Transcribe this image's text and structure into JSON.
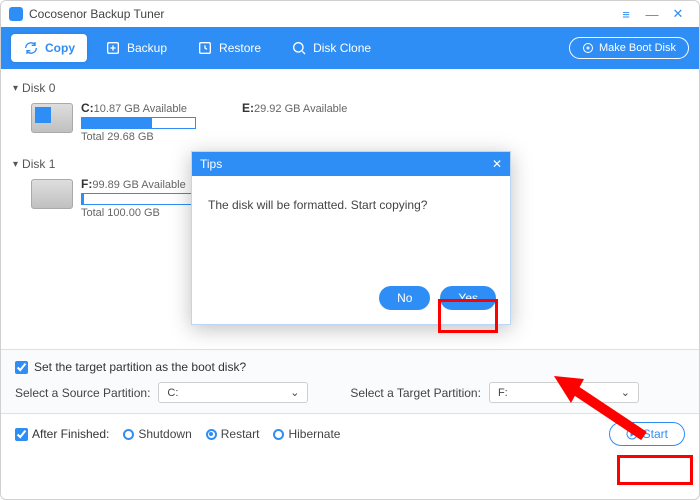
{
  "app_title": "Cocosenor Backup Tuner",
  "window": {
    "menu_icon": "≡",
    "min": "—",
    "close": "✕"
  },
  "toolbar": {
    "copy": "Copy",
    "backup": "Backup",
    "restore": "Restore",
    "diskclone": "Disk Clone",
    "bootdisk": "Make Boot Disk"
  },
  "disk0": {
    "label": "Disk 0",
    "c_drive": "C:",
    "c_avail": "10.87 GB Available",
    "c_total": "Total 29.68 GB",
    "c_fill": "62%",
    "e_drive": "E:",
    "e_avail": "29.92 GB Available"
  },
  "disk1": {
    "label": "Disk 1",
    "f_drive": "F:",
    "f_avail": "99.89 GB Available",
    "f_total": "Total 100.00 GB",
    "f_fill": "2%"
  },
  "panelA": {
    "chk_label": "Set the target partition as the boot disk?",
    "src_label": "Select a Source Partition:",
    "src_value": "C:",
    "tgt_label": "Select a Target Partition:",
    "tgt_value": "F:"
  },
  "panelB": {
    "after": "After Finished:",
    "shutdown": "Shutdown",
    "restart": "Restart",
    "hibernate": "Hibernate",
    "start": "Start"
  },
  "modal": {
    "title": "Tips",
    "msg": "The disk will be formatted. Start copying?",
    "no": "No",
    "yes": "Yes"
  }
}
